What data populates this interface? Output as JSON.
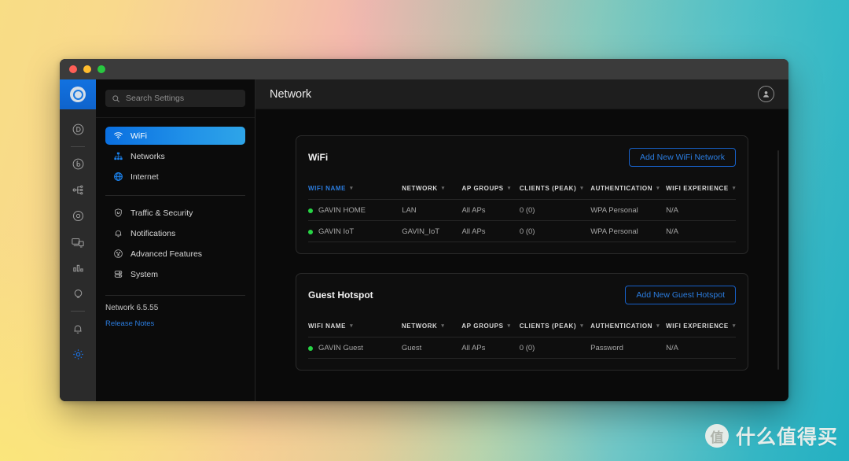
{
  "watermark": {
    "badge": "值",
    "text": "什么值得买"
  },
  "window": {
    "topbar": {
      "title": "Network",
      "avatar_icon": "user-avatar-icon"
    }
  },
  "rail": {
    "logo_icon": "unifi-logo-icon",
    "items": [
      {
        "name": "dashboard",
        "icon": "circle-d-icon",
        "active": false
      },
      {
        "name": "protect",
        "icon": "circle-b-icon",
        "active": false
      },
      {
        "name": "topology",
        "icon": "topology-icon",
        "active": false
      },
      {
        "name": "devices",
        "icon": "target-icon",
        "active": false
      },
      {
        "name": "clients",
        "icon": "screens-icon",
        "active": false
      },
      {
        "name": "insights",
        "icon": "bar-chart-icon",
        "active": false
      },
      {
        "name": "innovation",
        "icon": "bulb-icon",
        "active": false
      },
      {
        "name": "notifications",
        "icon": "bell-icon",
        "active": false
      },
      {
        "name": "settings",
        "icon": "gear-icon",
        "active": true
      }
    ]
  },
  "sidebar": {
    "search": {
      "placeholder": "Search Settings",
      "value": "",
      "icon": "search-icon"
    },
    "group_primary": [
      {
        "label": "WiFi",
        "icon": "wifi-icon",
        "selected": true
      },
      {
        "label": "Networks",
        "icon": "networks-icon",
        "selected": false
      },
      {
        "label": "Internet",
        "icon": "internet-globe-icon",
        "selected": false
      }
    ],
    "group_secondary": [
      {
        "label": "Traffic & Security",
        "icon": "shield-icon",
        "selected": false
      },
      {
        "label": "Notifications",
        "icon": "bell-icon",
        "selected": false
      },
      {
        "label": "Advanced Features",
        "icon": "advanced-features-icon",
        "selected": false
      },
      {
        "label": "System",
        "icon": "system-icon",
        "selected": false
      }
    ],
    "version": "Network 6.5.55",
    "release_notes": "Release Notes"
  },
  "main": {
    "wifi_card": {
      "title": "WiFi",
      "action_label": "Add New WiFi Network",
      "columns": [
        {
          "label": "WIFI NAME",
          "accent": true,
          "sortable": true
        },
        {
          "label": "NETWORK",
          "accent": false,
          "sortable": true
        },
        {
          "label": "AP GROUPS",
          "accent": false,
          "sortable": true
        },
        {
          "label": "CLIENTS (PEAK)",
          "accent": false,
          "sortable": true
        },
        {
          "label": "AUTHENTICATION",
          "accent": false,
          "sortable": true
        },
        {
          "label": "WIFI EXPERIENCE",
          "accent": false,
          "sortable": true
        }
      ],
      "rows": [
        {
          "status": "online",
          "name": "GAVIN HOME",
          "network": "LAN",
          "ap_groups": "All APs",
          "clients": "0 (0)",
          "auth": "WPA Personal",
          "experience": "N/A"
        },
        {
          "status": "online",
          "name": "GAVIN IoT",
          "network": "GAVIN_IoT",
          "ap_groups": "All APs",
          "clients": "0 (0)",
          "auth": "WPA Personal",
          "experience": "N/A"
        }
      ]
    },
    "guest_card": {
      "title": "Guest Hotspot",
      "action_label": "Add New Guest Hotspot",
      "columns": [
        {
          "label": "WIFI NAME",
          "accent": false,
          "sortable": true
        },
        {
          "label": "NETWORK",
          "accent": false,
          "sortable": true
        },
        {
          "label": "AP GROUPS",
          "accent": false,
          "sortable": true
        },
        {
          "label": "CLIENTS (PEAK)",
          "accent": false,
          "sortable": true
        },
        {
          "label": "AUTHENTICATION",
          "accent": false,
          "sortable": true
        },
        {
          "label": "WIFI EXPERIENCE",
          "accent": false,
          "sortable": true
        }
      ],
      "rows": [
        {
          "status": "online",
          "name": "GAVIN Guest",
          "network": "Guest",
          "ap_groups": "All APs",
          "clients": "0 (0)",
          "auth": "Password",
          "experience": "N/A"
        }
      ]
    }
  },
  "colors": {
    "accent_blue": "#2b7de0",
    "status_green": "#27d545",
    "window_bg": "#0a0a0a",
    "rail_bg": "#2b2b2b"
  }
}
